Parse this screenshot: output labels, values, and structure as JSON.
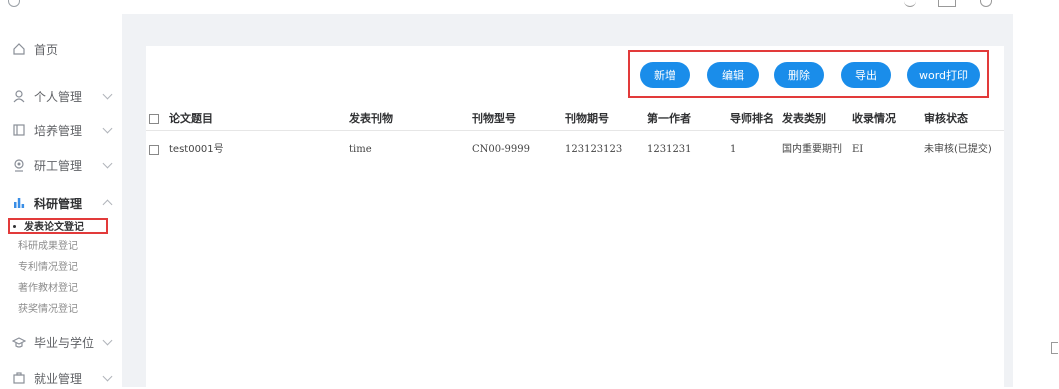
{
  "sidebar": {
    "items": [
      {
        "label": "首页",
        "icon": "home-icon"
      },
      {
        "label": "个人管理",
        "icon": "user-icon"
      },
      {
        "label": "培养管理",
        "icon": "book-icon"
      },
      {
        "label": "研工管理",
        "icon": "people-icon"
      },
      {
        "label": "科研管理",
        "icon": "bar-chart-icon"
      },
      {
        "label": "毕业与学位",
        "icon": "graduation-cap-icon"
      },
      {
        "label": "就业管理",
        "icon": "briefcase-icon"
      }
    ],
    "sub_items": [
      "发表论文登记",
      "科研成果登记",
      "专利情况登记",
      "著作教材登记",
      "获奖情况登记"
    ]
  },
  "toolbar": {
    "add_label": "新增",
    "edit_label": "编辑",
    "delete_label": "删除",
    "export_label": "导出",
    "print_label": "word打印"
  },
  "table": {
    "columns": [
      "论文题目",
      "发表刊物",
      "刊物型号",
      "刊物期号",
      "第一作者",
      "导师排名",
      "发表类别",
      "收录情况",
      "审核状态"
    ],
    "rows": [
      [
        "test0001号",
        "time",
        "CN00-9999",
        "123123123",
        "1231231",
        "1",
        "国内重要期刊",
        "EI",
        "未审核(已提交)"
      ]
    ]
  },
  "colors": {
    "accent": "#1a8dea",
    "highlight_border": "#e23a3a",
    "content_bg": "#f0f2f5"
  }
}
